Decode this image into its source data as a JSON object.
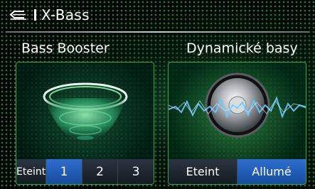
{
  "header": {
    "title": "X-Bass",
    "back_icon": "back-arrow-icon"
  },
  "bass_booster": {
    "title": "Bass Booster",
    "options": [
      "Eteint",
      "1",
      "2",
      "3"
    ],
    "selected": "1"
  },
  "dynamic_bass": {
    "title": "Dynamické basy",
    "options": [
      "Eteint",
      "Allumé"
    ],
    "selected": "Allumé"
  },
  "colors": {
    "accent_green": "#3aa24a",
    "selected_blue": "#2f6fcf"
  }
}
